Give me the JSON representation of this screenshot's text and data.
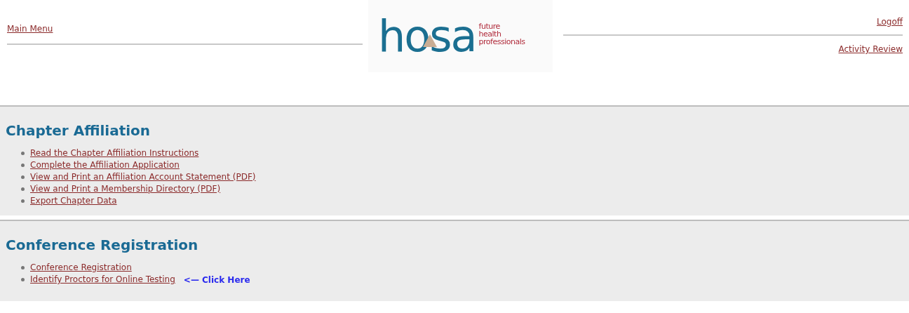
{
  "header": {
    "left_link": "Main Menu",
    "logo": {
      "word": "hosa",
      "tagline": [
        "future",
        "health",
        "professionals"
      ]
    },
    "right_links": [
      "Logoff",
      "Activity Review"
    ]
  },
  "sections": [
    {
      "title": "Chapter Affiliation",
      "links": [
        {
          "label": "Read the Chapter Affiliation Instructions"
        },
        {
          "label": "Complete the Affiliation Application"
        },
        {
          "label": "View and Print an Affiliation Account Statement (PDF)"
        },
        {
          "label": "View and Print a Membership Directory (PDF)"
        },
        {
          "label": "Export Chapter Data"
        }
      ]
    },
    {
      "title": "Conference Registration",
      "links": [
        {
          "label": "Conference Registration"
        },
        {
          "label": "Identify Proctors for Online Testing",
          "note": "<— Click Here"
        }
      ]
    }
  ]
}
